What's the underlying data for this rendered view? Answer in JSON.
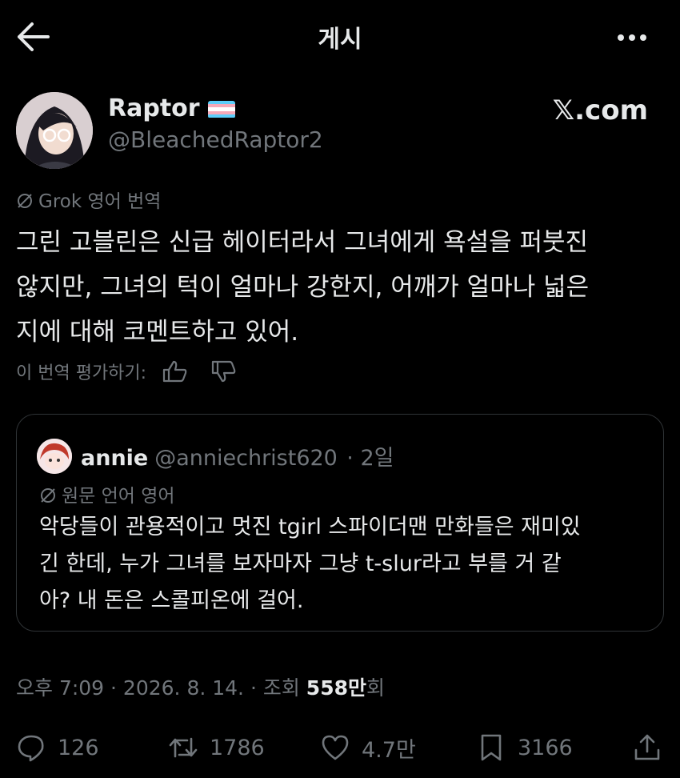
{
  "header": {
    "title": "게시"
  },
  "author": {
    "name": "Raptor",
    "handle": "@BleachedRaptor2",
    "watermark": "𝕏.com"
  },
  "translation": {
    "label": "Grok 영어 번역",
    "lines": [
      "그린 고블린은 신급 헤이터라서 그녀에게 욕설을 퍼붓진",
      "않지만, 그녀의 턱이 얼마나 강한지, 어깨가 얼마나 넓은",
      "지에 대해 코멘트하고 있어."
    ],
    "rate_label": "이 번역 평가하기:"
  },
  "quote": {
    "name": "annie",
    "handle": "@anniechrist620",
    "time": "· 2일",
    "orig_label": "원문 언어 영어",
    "lines": [
      "악당들이 관용적이고 멋진 tgirl 스파이더맨 만화들은 재미있",
      "긴 한데, 누가 그녀를 보자마자 그냥 t-slur라고 부를 거 같",
      "아? 내 돈은 스콜피온에 걸어."
    ]
  },
  "meta": {
    "time": "오후 7:09 · 2026. 8. 14. · 조회 ",
    "views": "558만",
    "views_suffix": "회"
  },
  "actions": {
    "replies": "126",
    "reposts": "1786",
    "likes": "4.7만",
    "bookmarks": "3166"
  },
  "colors": {
    "background": "#000000",
    "text": "#e7e9ea",
    "muted": "#71767b",
    "border": "#2f3336"
  }
}
